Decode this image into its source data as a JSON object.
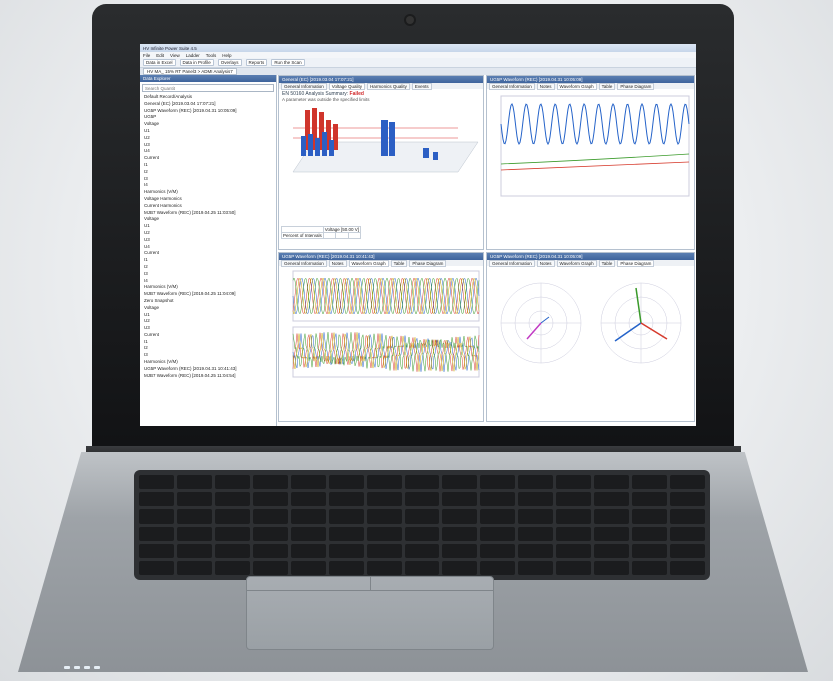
{
  "app": {
    "title": "HV Infinite Power Suite 4.5",
    "menu": [
      "File",
      "Edit",
      "View",
      "Ladder",
      "Tools",
      "Help"
    ],
    "toolbar": [
      "Data in Excel",
      "Data in Profile",
      "Overlays",
      "Reports",
      "Run the Scan"
    ],
    "doc_tab": "HV MA_ 15% RT Panel3 > ADMI Analysis7"
  },
  "explorer": {
    "header": "Data Explorer",
    "search_placeholder": "Search Quantit",
    "tree": [
      "Default Record/Analysis",
      "General (EC) [2019.03.04 17:07:21]",
      "UG5P Waveform (REC) [2019.04.31 10:05:09]",
      "UG5P",
      "Voltage",
      "U1",
      "U2",
      "U3",
      "U4",
      "Current",
      "I1",
      "I2",
      "I3",
      "I4",
      "Harmonics (V/M)",
      "Voltage Harmonics",
      "Current Harmonics",
      "MJB7 Waveform (REC) [2019.04.25 11:03:50]",
      "Voltage",
      "U1",
      "U2",
      "U3",
      "U4",
      "Current",
      "I1",
      "I2",
      "I3",
      "I4",
      "Harmonics (V/M)",
      "MJB7 Waveform (REC) [2019.04.25 11:04:09]",
      "Zero Snapshot",
      "Voltage",
      "U1",
      "U2",
      "U3",
      "Current",
      "I1",
      "I2",
      "I3",
      "Harmonics (V/M)",
      "UG5P Waveform (REC) [2019.04.31 10:41:43]",
      "MJB7 Waveform (REC) [2019.04.25 11:04:54]"
    ]
  },
  "panes": {
    "general": {
      "header": "General (EC) [2019.03.04 17:07:21]",
      "tabs": [
        "General Information",
        "Voltage Quality",
        "Harmonics Quality",
        "Events"
      ],
      "title": "EN 50160 Analysis Summary:",
      "status": "Failed",
      "subtitle": "A parameter was outside the specified limits",
      "table_header": "Voltage [50.00 V]",
      "row_label": "Percent of Intervals"
    },
    "waveform_top": {
      "header": "UG5P Waveform (REC) [2019.04.31 10:05:09]",
      "tabs": [
        "General Information",
        "Notes",
        "Waveform Graph",
        "Table",
        "Phase Diagram"
      ]
    },
    "waveform_mid": {
      "header": "UG5P Waveform (REC) [2019.04.31 10:41:43]",
      "tabs": [
        "General Information",
        "Notes",
        "Waveform Graph",
        "Table",
        "Phase Diagram"
      ]
    },
    "phase": {
      "header": "UG5P Waveform (REC) [2019.04.31 10:05:09]",
      "tabs": [
        "General Information",
        "Notes",
        "Waveform Graph",
        "Table",
        "Phase Diagram"
      ]
    }
  },
  "colors": {
    "wave_blue": "#2563c9",
    "wave_green": "#3a9a2a",
    "wave_red": "#d63a2c",
    "bar_red": "#d0352c",
    "bar_blue": "#2c5fc4"
  }
}
